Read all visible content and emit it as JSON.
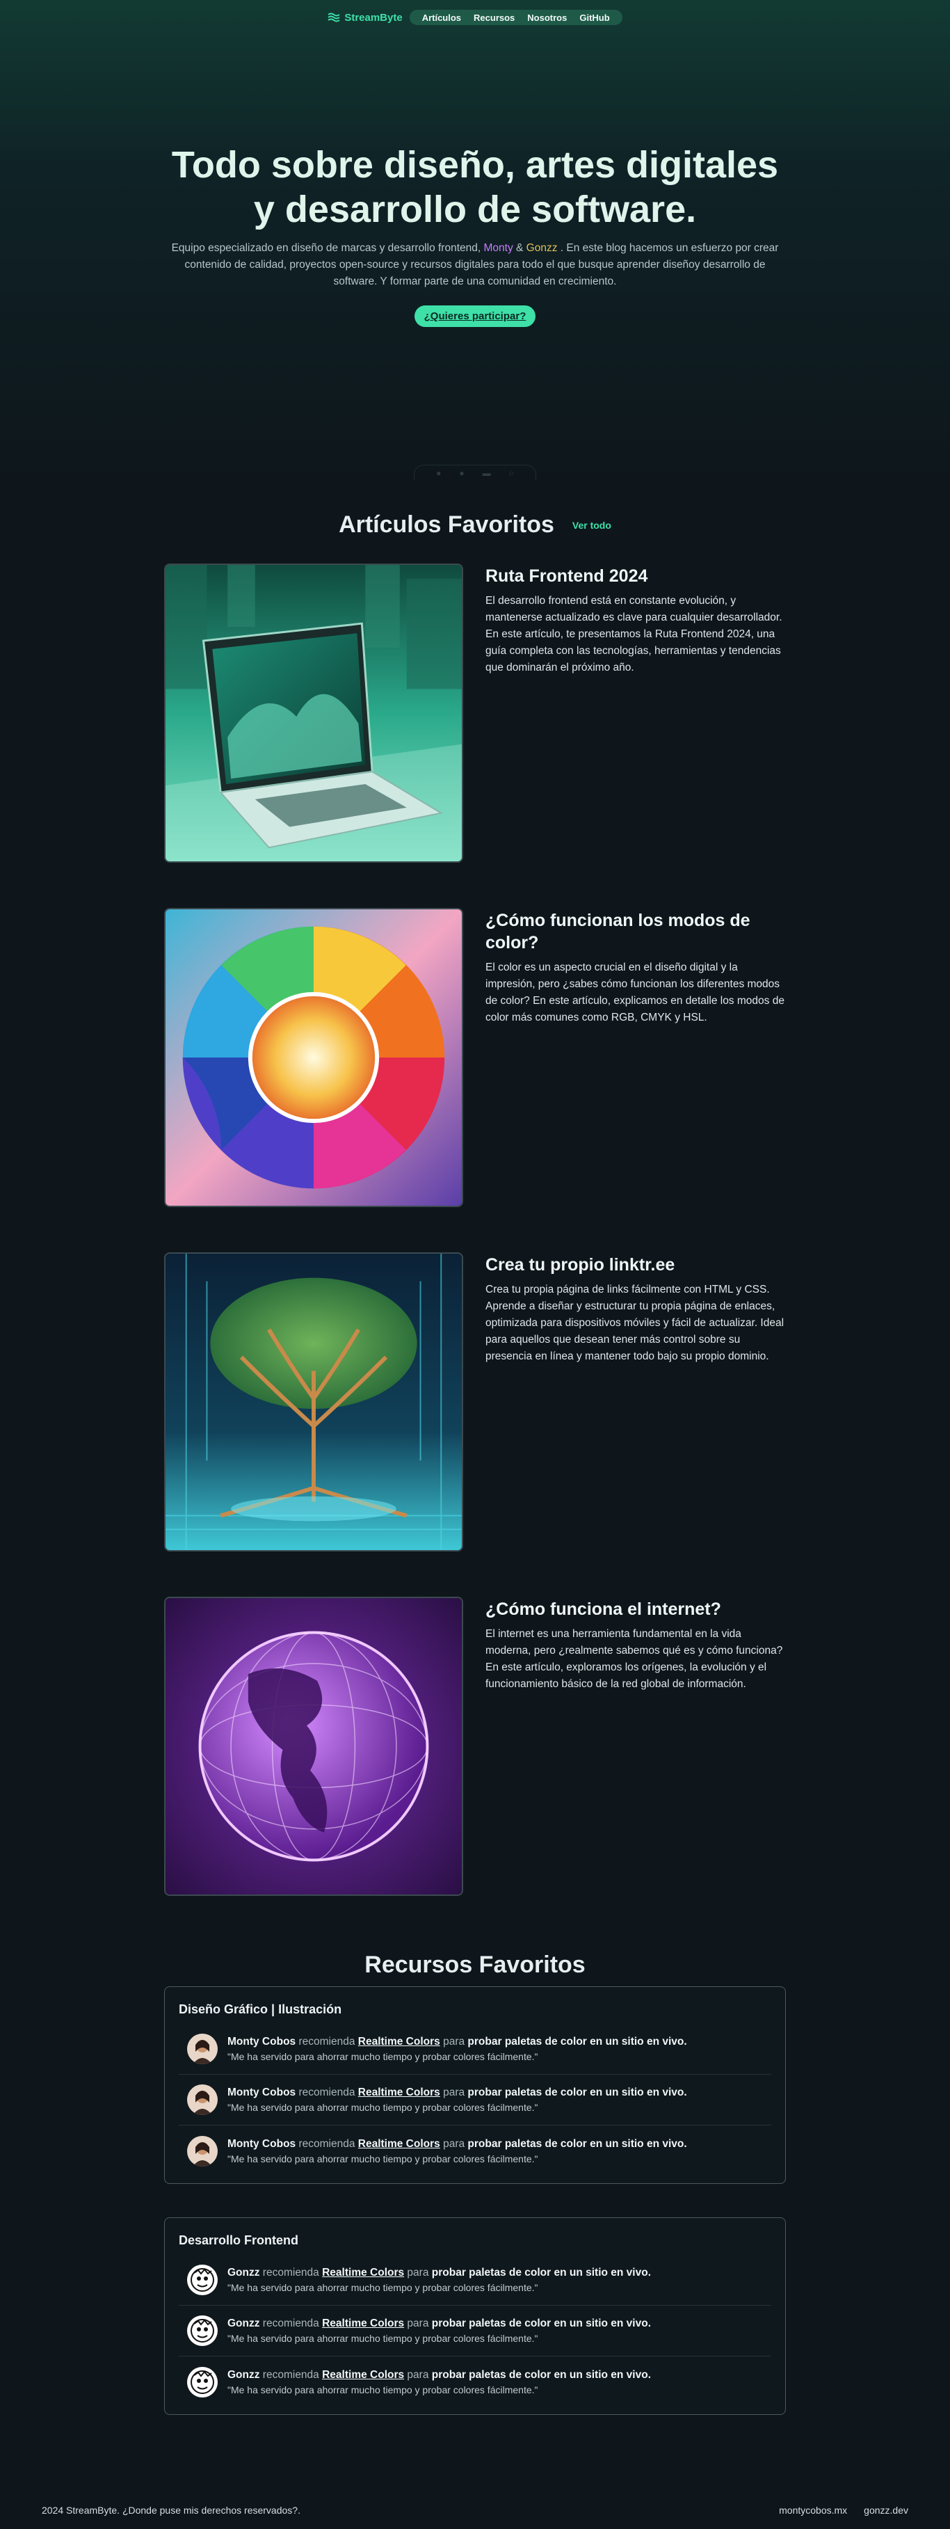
{
  "nav": {
    "brand": "StreamByte",
    "links": [
      "Artículos",
      "Recursos",
      "Nosotros",
      "GitHub"
    ]
  },
  "hero": {
    "title": "Todo sobre diseño, artes digitales y desarrollo de software.",
    "desc_before": "Equipo especializado en diseño de marcas y desarrollo frontend, ",
    "monty": "Monty",
    "amp": " & ",
    "gonzz": "Gonzz",
    "desc_after": " . En este blog hacemos un esfuerzo por crear contenido de calidad, proyectos open-source y recursos digitales para todo el que busque aprender diseñoy desarrollo de software. Y formar parte de una comunidad en crecimiento.",
    "cta": "¿Quieres participar?"
  },
  "articles_section": {
    "title": "Artículos Favoritos",
    "see_all": "Ver todo"
  },
  "articles": [
    {
      "title": "Ruta Frontend 2024",
      "body": "El desarrollo frontend está en constante evolución, y mantenerse actualizado es clave para cualquier desarrollador. En este artículo, te presentamos la Ruta Frontend 2024, una guía completa con las tecnologías, herramientas y tendencias que dominarán el próximo año.",
      "image": "laptop-image"
    },
    {
      "title": "¿Cómo funcionan los modos de color?",
      "body": "El color es un aspecto crucial en el diseño digital y la impresión, pero ¿sabes cómo funcionan los diferentes modos de color? En este artículo, explicamos en detalle los modos de color más comunes como RGB, CMYK y HSL.",
      "image": "color-wheel-image"
    },
    {
      "title": "Crea tu propio linktr.ee",
      "body": "Crea tu propia página de links fácilmente con HTML y CSS. Aprende a diseñar y estructurar tu propia página de enlaces, optimizada para dispositivos móviles y fácil de actualizar. Ideal para aquellos que desean tener más control sobre su presencia en línea y mantener todo bajo su propio dominio.",
      "image": "circuit-tree-image"
    },
    {
      "title": "¿Cómo funciona el internet?",
      "body": "El internet es una herramienta fundamental en la vida moderna, pero ¿realmente sabemos qué es y cómo funciona? En este artículo, exploramos los orígenes, la evolución y el funcionamiento básico de la red global de información.",
      "image": "globe-image"
    }
  ],
  "resources": {
    "title": "Recursos Favoritos",
    "groups": [
      {
        "title": "Diseño Gráfico | Ilustración",
        "items": [
          {
            "author": "Monty Cobos",
            "verb": " recomienda ",
            "link": "Realtime Colors",
            "mid": " para ",
            "purpose": "probar paletas de color en un sitio en vivo.",
            "quote": "\"Me ha servido para ahorrar mucho tiempo y probar colores fácilmente.\""
          },
          {
            "author": "Monty Cobos",
            "verb": " recomienda ",
            "link": "Realtime Colors",
            "mid": " para ",
            "purpose": "probar paletas de color en un sitio en vivo.",
            "quote": "\"Me ha servido para ahorrar mucho tiempo y probar colores fácilmente.\""
          },
          {
            "author": "Monty Cobos",
            "verb": " recomienda ",
            "link": "Realtime Colors",
            "mid": " para ",
            "purpose": "probar paletas de color en un sitio en vivo.",
            "quote": "\"Me ha servido para ahorrar mucho tiempo y probar colores fácilmente.\""
          }
        ]
      },
      {
        "title": "Desarrollo Frontend",
        "items": [
          {
            "author": "Gonzz",
            "verb": " recomienda ",
            "link": "Realtime Colors",
            "mid": " para ",
            "purpose": "probar paletas de color en un sitio en vivo.",
            "quote": "\"Me ha servido para ahorrar mucho tiempo y probar colores fácilmente.\""
          },
          {
            "author": "Gonzz",
            "verb": " recomienda ",
            "link": "Realtime Colors",
            "mid": " para ",
            "purpose": "probar paletas de color en un sitio en vivo.",
            "quote": "\"Me ha servido para ahorrar mucho tiempo y probar colores fácilmente.\""
          },
          {
            "author": "Gonzz",
            "verb": " recomienda ",
            "link": "Realtime Colors",
            "mid": " para ",
            "purpose": "probar paletas de color en un sitio en vivo.",
            "quote": "\"Me ha servido para ahorrar mucho tiempo y probar colores fácilmente.\""
          }
        ]
      }
    ]
  },
  "footer": {
    "copy": "2024 StreamByte. ¿Donde puse mis derechos reservados?.",
    "links": [
      "montycobos.mx",
      "gonzz.dev"
    ]
  },
  "colors": {
    "accent": "#3ee0a8",
    "background": "#0e161b",
    "monty": "#c77dff",
    "gonzz": "#e2c15a"
  }
}
